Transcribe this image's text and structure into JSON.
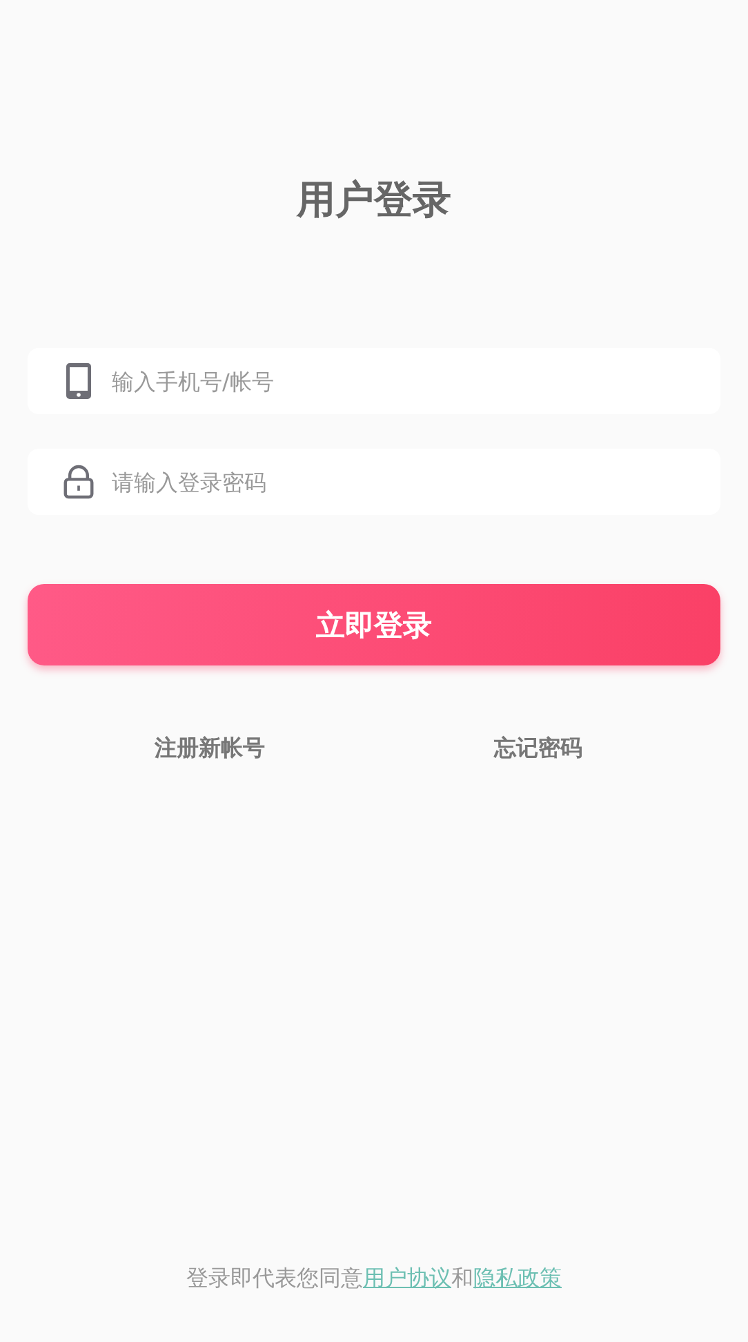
{
  "title": "用户登录",
  "fields": [
    {
      "kind": "phone",
      "placeholder": "输入手机号/帐号"
    },
    {
      "kind": "password",
      "placeholder": "请输入登录密码"
    }
  ],
  "login_button": "立即登录",
  "links": [
    "注册新帐号",
    "忘记密码"
  ],
  "agreement": {
    "prefix": "登录即代表您同意",
    "link_1": "用户协议",
    "conjunction": "和",
    "link_2": "隐私政策"
  }
}
